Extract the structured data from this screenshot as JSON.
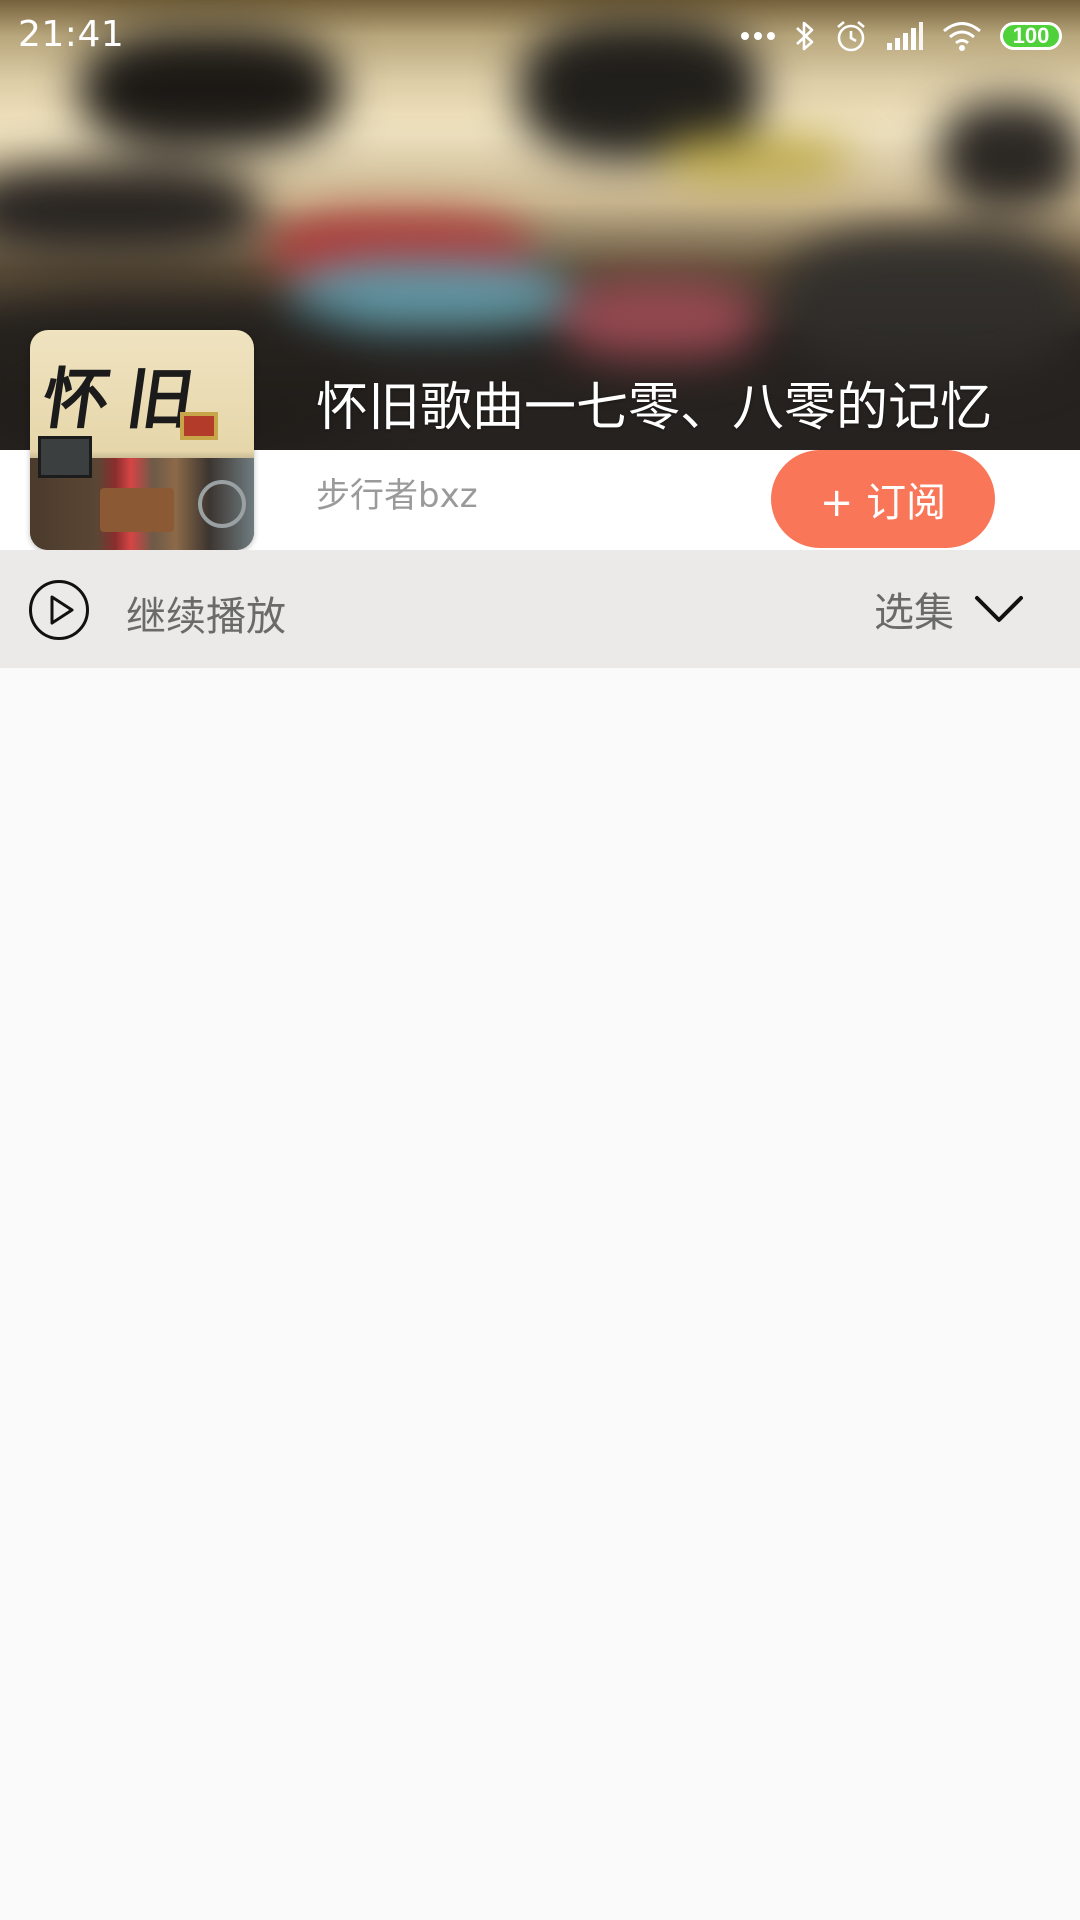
{
  "status_bar": {
    "time": "21:41",
    "battery_level": "100",
    "icons": [
      "more-dots-icon",
      "bluetooth-icon",
      "alarm-icon",
      "signal-icon",
      "wifi-icon",
      "battery-icon"
    ],
    "battery_color": "#4fd13a"
  },
  "album": {
    "cover_text": "怀旧",
    "title": "怀旧歌曲一七零、八零的记忆",
    "author": "步行者bxz"
  },
  "subscribe": {
    "label": "+ 订阅",
    "color": "#f97659"
  },
  "play_bar": {
    "continue_label": "继续播放",
    "select_label": "选集",
    "icons": [
      "play-circle-icon",
      "chevron-down-icon"
    ]
  }
}
